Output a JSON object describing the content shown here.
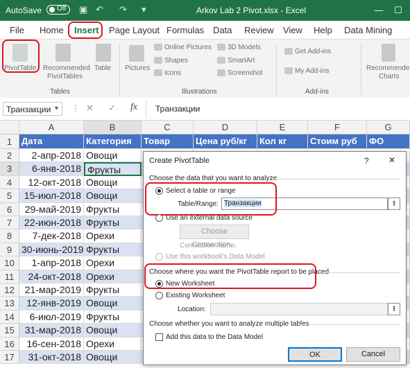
{
  "titlebar": {
    "autosave_label": "AutoSave",
    "autosave_state": "Off",
    "filename": "Arkov Lab 2 Pivot.xlsx - Excel",
    "min": "—",
    "max": "☐",
    "close": "✕"
  },
  "tabs": [
    "File",
    "Home",
    "Insert",
    "Page Layout",
    "Formulas",
    "Data",
    "Review",
    "View",
    "Help",
    "Data Mining"
  ],
  "active_tab": "Insert",
  "ribbon": {
    "pivottable": "PivotTable",
    "recommended_pivottables_1": "Recommended",
    "recommended_pivottables_2": "PivotTables",
    "table": "Table",
    "group_tables": "Tables",
    "pictures": "Pictures",
    "online_pictures": "Online Pictures",
    "shapes": "Shapes",
    "icons": "Icons",
    "models_3d": "3D Models",
    "smartart": "SmartArt",
    "screenshot": "Screenshot",
    "group_illustrations": "Illustrations",
    "get_addins": "Get Add-ins",
    "my_addins": "My Add-ins",
    "group_addins": "Add-ins",
    "recommended_charts_1": "Recommende",
    "recommended_charts_2": "Charts"
  },
  "formula_bar": {
    "name_box": "Транзакции",
    "fx": "fx",
    "value": "Транзакции"
  },
  "columns": [
    "A",
    "B",
    "C",
    "D",
    "E",
    "F",
    "G"
  ],
  "header_row": [
    "Дата",
    "Категория",
    "Товар",
    "Цена руб/кг",
    "Кол кг",
    "Стоим руб",
    "ФО"
  ],
  "rows": [
    {
      "num": "2",
      "date": "2-апр-2018",
      "cat": "Овощи"
    },
    {
      "num": "3",
      "date": "6-янв-2018",
      "cat": "Фрукты"
    },
    {
      "num": "4",
      "date": "12-окт-2018",
      "cat": "Овощи"
    },
    {
      "num": "5",
      "date": "15-июл-2018",
      "cat": "Овощи"
    },
    {
      "num": "6",
      "date": "29-май-2019",
      "cat": "Фрукты"
    },
    {
      "num": "7",
      "date": "22-июн-2018",
      "cat": "Фрукты"
    },
    {
      "num": "8",
      "date": "7-дек-2018",
      "cat": "Орехи"
    },
    {
      "num": "9",
      "date": "30-июнь-2019",
      "cat": "Фрукты"
    },
    {
      "num": "10",
      "date": "1-апр-2018",
      "cat": "Орехи"
    },
    {
      "num": "11",
      "date": "24-окт-2018",
      "cat": "Орехи"
    },
    {
      "num": "12",
      "date": "21-мар-2019",
      "cat": "Фрукты"
    },
    {
      "num": "13",
      "date": "12-янв-2019",
      "cat": "Овощи"
    },
    {
      "num": "14",
      "date": "6-июл-2019",
      "cat": "Фрукты"
    },
    {
      "num": "15",
      "date": "31-мар-2018",
      "cat": "Овощи"
    },
    {
      "num": "16",
      "date": "16-сен-2018",
      "cat": "Орехи"
    },
    {
      "num": "17",
      "date": "31-окт-2018",
      "cat": "Овощи"
    }
  ],
  "dialog": {
    "title": "Create PivotTable",
    "help": "?",
    "close": "✕",
    "section1": "Choose the data that you want to analyze",
    "select_range": "Select a table or range",
    "table_range_label": "Table/Range:",
    "table_range_value": "Транзакции",
    "external_source": "Use an external data source",
    "choose_connection": "Choose Connection...",
    "connection_name": "Connection name:",
    "data_model": "Use this workbook's Data Model",
    "section2": "Choose where you want the PivotTable report to be placed",
    "new_ws": "New Worksheet",
    "existing_ws": "Existing Worksheet",
    "location_label": "Location:",
    "section3": "Choose whether you want to analyze multiple tables",
    "add_to_model": "Add this data to the Data Model",
    "ok": "OK",
    "cancel": "Cancel"
  }
}
